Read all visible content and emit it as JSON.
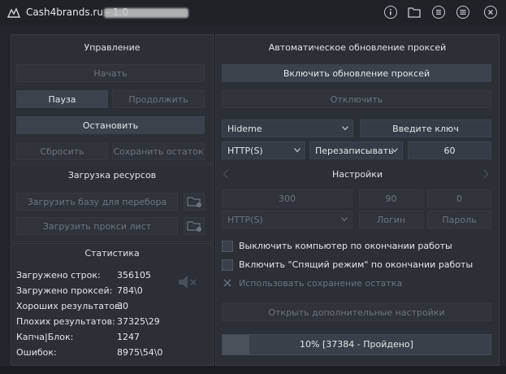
{
  "window": {
    "title": "Cash4brands.ru - 1.0"
  },
  "control": {
    "header": "Управление",
    "start": "Начать",
    "pause": "Пауза",
    "resume": "Продолжить",
    "stop": "Остановить",
    "reset": "Сбросить",
    "save_remainder": "Сохранить остаток"
  },
  "resources": {
    "header": "Загрузка ресурсов",
    "load_base": "Загрузить базу для перебора",
    "load_proxy": "Загрузить прокси лист"
  },
  "stats": {
    "header": "Статистика",
    "rows": [
      {
        "label": "Загружено строк:",
        "value": "356105"
      },
      {
        "label": "Загружено проксей:",
        "value": "784\\0"
      },
      {
        "label": "Хороших результатов:",
        "value": "30"
      },
      {
        "label": "Плохих результатов:",
        "value": "37325\\29"
      },
      {
        "label": "Капча|Блок:",
        "value": "1247"
      },
      {
        "label": "Ошибок:",
        "value": "8975\\54\\0"
      }
    ]
  },
  "proxy_update": {
    "header": "Автоматическое обновление проксей",
    "enable": "Включить обновление проксей",
    "disable": "Отключить",
    "provider": "Hideme",
    "key_button": "Введите ключ",
    "protocol": "HTTP(S)",
    "mode": "Перезаписывать",
    "interval": "60"
  },
  "settings": {
    "header": "Настройки",
    "threads": "300",
    "timeout": "90",
    "retries": "0",
    "proxy_type": "HTTP(S)",
    "login_placeholder": "Логин",
    "password_placeholder": "Пароль"
  },
  "options": {
    "shutdown": "Выключить компьютер по окончании работы",
    "sleep": "Включить \"Спящий режим\" по окончании работы",
    "use_save": "Использовать сохранение остатка"
  },
  "extra_settings": "Открыть дополнительные настройки",
  "progress": {
    "text": "10% [37384 - Пройдено]",
    "value": 0.1
  },
  "colors": {
    "background": "#23272d",
    "panel": "#2b3037",
    "button": "#363c45",
    "text": "#e3e6ea",
    "disabled_text": "#6e747c"
  }
}
